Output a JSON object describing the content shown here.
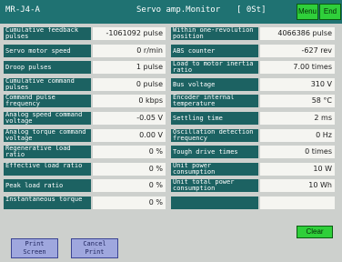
{
  "title_bar": {
    "model": "MR-J4-A",
    "title": "Servo amp.Monitor",
    "unit": "[ 0St]",
    "menu_label": "Menu",
    "end_label": "End"
  },
  "left_items": [
    {
      "label": "Cumulative feedback pulses",
      "value": "-1061092 pulse"
    },
    {
      "label": "Servo motor speed",
      "value": "0 r/min"
    },
    {
      "label": "Droop pulses",
      "value": "1 pulse"
    },
    {
      "label": "Cumulative command pulses",
      "value": "0 pulse"
    },
    {
      "label": "Command pulse frequency",
      "value": "0 kbps"
    },
    {
      "label": "Analog speed command voltage",
      "value": "-0.05 V"
    },
    {
      "label": "Analog torque command voltage",
      "value": "0.00 V"
    },
    {
      "label": "Regenerative load ratio",
      "value": "0 %"
    },
    {
      "label": "Effective load ratio",
      "value": "0 %"
    },
    {
      "label": "Peak load ratio",
      "value": "0 %"
    },
    {
      "label": "Instantaneous torque",
      "value": "0 %"
    }
  ],
  "right_items": [
    {
      "label": "Within one-revolution position",
      "value": "4066386 pulse"
    },
    {
      "label": "ABS counter",
      "value": "-627 rev"
    },
    {
      "label": "Load to motor inertia ratio",
      "value": "7.00 times"
    },
    {
      "label": "Bus voltage",
      "value": "310 V"
    },
    {
      "label": "Encoder internal temperature",
      "value": "58 °C"
    },
    {
      "label": "Settling time",
      "value": "2 ms"
    },
    {
      "label": "Oscillation detection frequency",
      "value": "0 Hz"
    },
    {
      "label": "Tough drive times",
      "value": "0 times"
    },
    {
      "label": "Unit power consumption",
      "value": "10 W"
    },
    {
      "label": "Unit total power consumption",
      "value": "10 Wh"
    },
    {
      "label": "",
      "value": ""
    }
  ],
  "clear_label": "Clear",
  "bottom_buttons": {
    "print_screen": "Print Screen",
    "cancel_print": "Cancel Print"
  },
  "colors": {
    "title_bg": "#1f7272",
    "label_bg": "#1c6262",
    "value_bg": "#f5f5f1",
    "green_button": "#2fcf3a",
    "blue_button": "#9fa7de"
  }
}
